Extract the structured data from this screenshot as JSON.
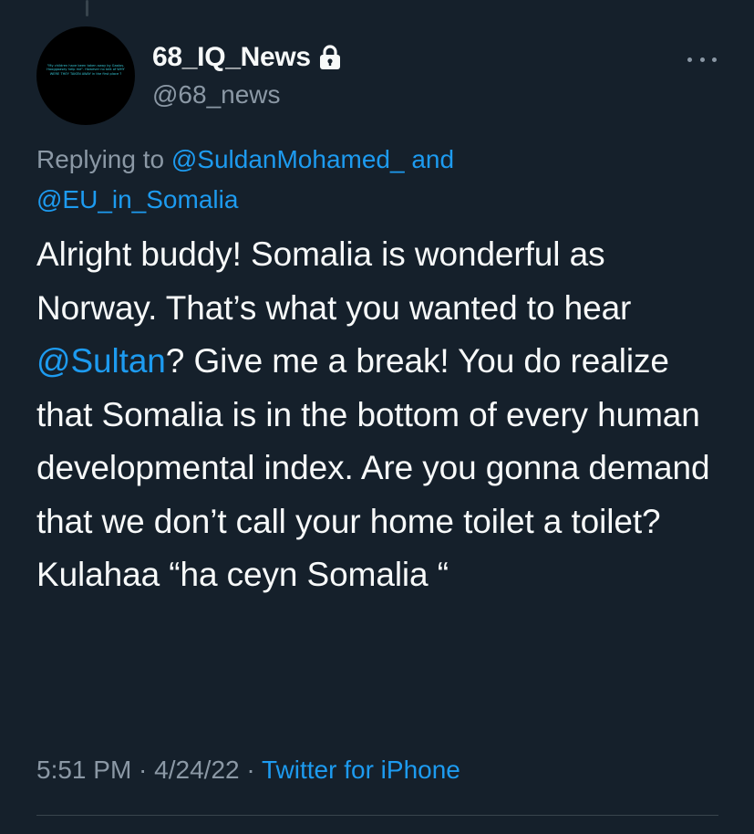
{
  "tweet": {
    "avatar_caption": "\"My children have been taken away by Gaalos. Hooggaasey help me\". However no talk of WHY WERE THEY TAKEN AWAY in the first place ?",
    "display_name": "68_IQ_News",
    "handle": "@68_news",
    "replying_prefix": "Replying to ",
    "reply_mention_1": "@SuldanMohamed_",
    "reply_and": " and",
    "reply_mention_2": "@EU_in_Somalia",
    "text_part_1": "Alright buddy! Somalia is wonderful as Norway. That’s what you wanted to hear ",
    "text_mention": "@Sultan",
    "text_part_2": "? Give me a break! You do realize that Somalia is in the bottom of every human developmental index. Are you gonna demand that we don’t call your home toilet a toilet? Kulahaa “ha ceyn Somalia “",
    "time": "5:51 PM",
    "separator_1": " · ",
    "date": "4/24/22",
    "separator_2": " · ",
    "source": "Twitter for iPhone"
  },
  "icons": {
    "protected": "lock-icon",
    "more": "more-horizontal-icon"
  },
  "colors": {
    "background": "#15202b",
    "link": "#1d9bf0",
    "secondary_text": "#8b98a5",
    "primary_text": "#f7f9f9"
  }
}
